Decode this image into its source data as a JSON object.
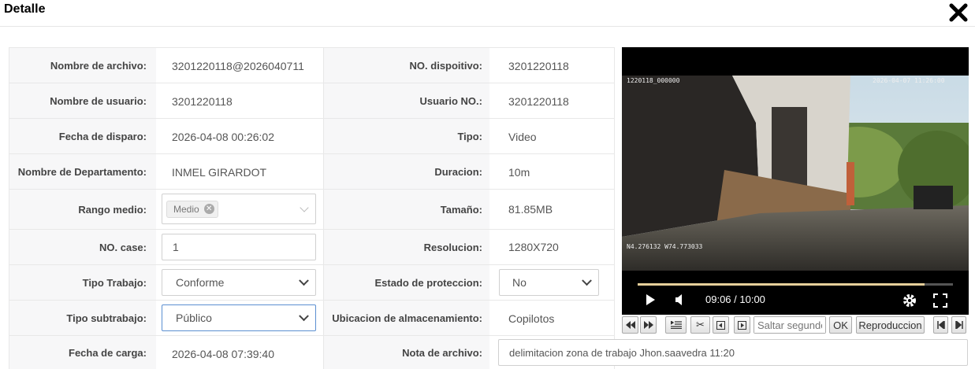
{
  "dialog": {
    "title": "Detalle"
  },
  "rows": [
    {
      "label1": "Nombre de archivo:",
      "value1": "3201220118@2026040711",
      "label2": "NO. dispoitivo:",
      "value2": "3201220118"
    },
    {
      "label1": "Nombre de usuario:",
      "value1": "3201220118",
      "label2": "Usuario NO.:",
      "value2": "3201220118"
    },
    {
      "label1": "Fecha de disparo:",
      "value1": "2026-04-08 00:26:02",
      "label2": "Tipo:",
      "value2": "Video"
    },
    {
      "label1": "Nombre de Departamento:",
      "value1": "INMEL GIRARDOT",
      "label2": "Duracion:",
      "value2": "10m"
    },
    {
      "label1": "Rango medio:",
      "value1": "",
      "label2": "Tamaño:",
      "value2": "81.85MB"
    },
    {
      "label1": "NO. case:",
      "value1": "1",
      "label2": "Resolucion:",
      "value2": "1280X720"
    },
    {
      "label1": "Tipo Trabajo:",
      "value1": "Conforme",
      "label2": "Estado de proteccion:",
      "value2": "No"
    },
    {
      "label1": "Tipo subtrabajo:",
      "value1": "Público",
      "label2": "Ubicacion de almacenamiento:",
      "value2": "Copilotos"
    },
    {
      "label1": "Fecha de carga:",
      "value1": "2026-04-08 07:39:40",
      "label2": "Nota de archivo:",
      "value2": "delimitacion zona de trabajo Jhon.saavedra 11:20"
    }
  ],
  "rango_medio": {
    "tag": "Medio"
  },
  "video": {
    "osd_left": "1220118_000000",
    "osd_right": "2026-04-07 11:26:00",
    "osd_coords": "N4.276132  W74.773033",
    "time": "09:06 / 10:00",
    "progress": 0.91
  },
  "toolbar": {
    "seek_placeholder": "Saltar segundos",
    "ok_label": "OK",
    "play_label": "Reproduccion"
  },
  "colors": {
    "accent_focus": "#5b8fd1",
    "progress": "#e6cf9a"
  }
}
